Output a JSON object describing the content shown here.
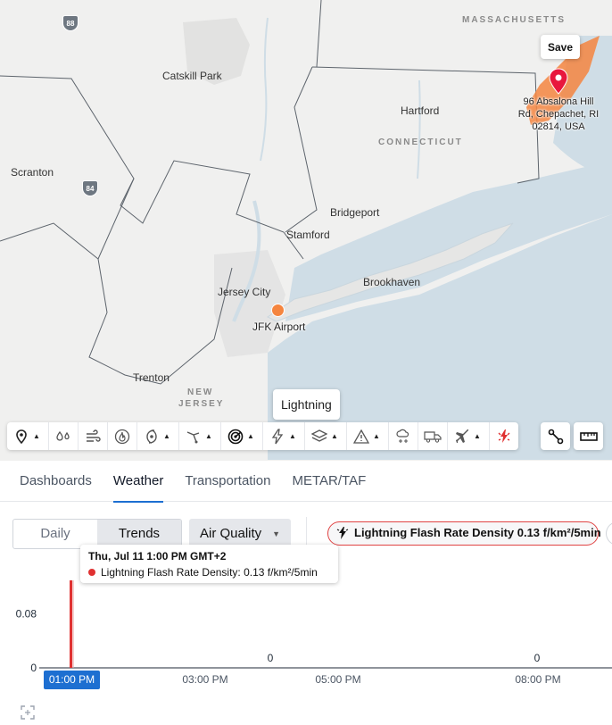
{
  "map": {
    "labels": {
      "massachusetts": "MASSACHUSETTS",
      "catskill": "Catskill Park",
      "hartford": "Hartford",
      "connecticut": "CONNECTICUT",
      "scranton": "Scranton",
      "bridgeport": "Bridgeport",
      "stamford": "Stamford",
      "brookhaven": "Brookhaven",
      "jersey_city": "Jersey City",
      "trenton": "Trenton",
      "new_jersey_1": "NEW",
      "new_jersey_2": "JERSEY"
    },
    "shields": {
      "i88": "88",
      "i84": "84"
    },
    "save_label": "Save",
    "pin_address": "96 Absalona Hill Rd, Chepachet, RI 02814, USA",
    "airport_label": "JFK Airport",
    "tooltip": "Lightning",
    "colors": {
      "water": "#cfdde6",
      "land": "#f0f0ef",
      "pin": "#e8173d",
      "airport": "#f5853f",
      "alert_zone": "#f5853f"
    }
  },
  "tabs": [
    {
      "label": "Dashboards",
      "active": false
    },
    {
      "label": "Weather",
      "active": true
    },
    {
      "label": "Transportation",
      "active": false
    },
    {
      "label": "METAR/TAF",
      "active": false
    }
  ],
  "controls": {
    "daily": "Daily",
    "trends": "Trends",
    "metric_select": "Air Quality",
    "chip": "Lightning Flash Rate Density 0.13 f/km²/5min"
  },
  "chart_data": {
    "type": "bar",
    "title": "",
    "xlabel": "",
    "ylabel": "",
    "x_ticks": [
      "01:00 PM",
      "03:00 PM",
      "05:00 PM",
      "08:00 PM"
    ],
    "y_ticks": [
      "0",
      "0.08"
    ],
    "ylim": [
      0,
      0.13
    ],
    "series": [
      {
        "name": "Lightning Flash Rate Density",
        "unit": "f/km²/5min",
        "color": "#e03131",
        "points": [
          {
            "x": "01:00 PM",
            "y": 0.13
          }
        ]
      }
    ],
    "data_labels": [
      "0",
      "0"
    ],
    "active_x": "01:00 PM",
    "tooltip": {
      "title": "Thu, Jul 11 1:00 PM GMT+2",
      "line": "Lightning Flash Rate Density: 0.13 f/km²/5min"
    }
  }
}
